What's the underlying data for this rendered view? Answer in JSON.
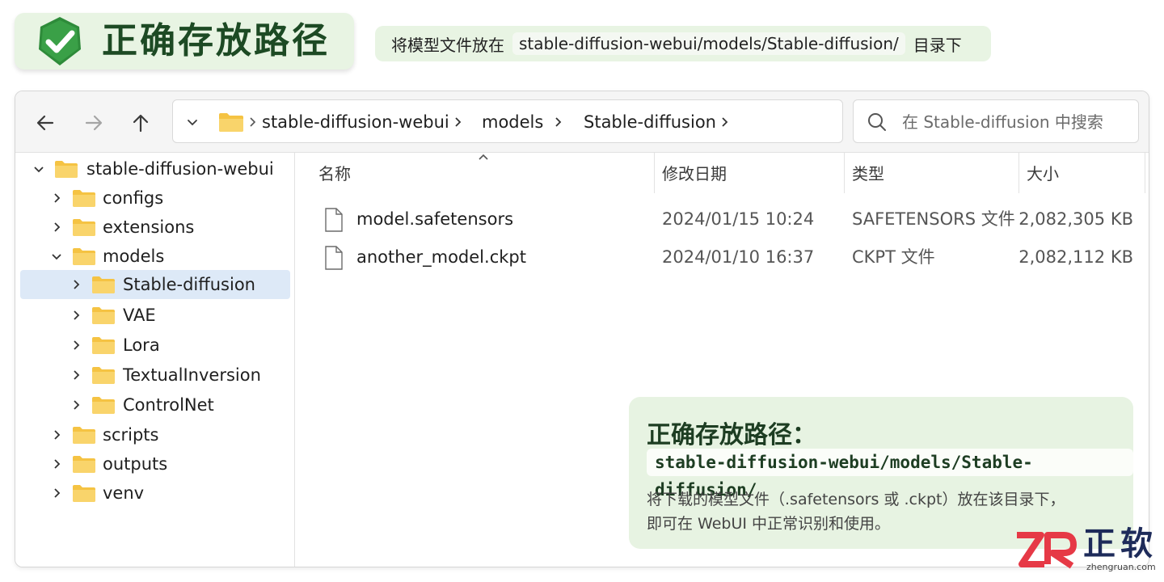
{
  "banner": {
    "title": "正确存放路径",
    "hint_prefix": "将模型文件放在",
    "hint_path": "stable-diffusion-webui/models/Stable-diffusion/",
    "hint_suffix": "目录下"
  },
  "toolbar": {
    "back_icon": "arrow-left-icon",
    "forward_icon": "arrow-right-icon",
    "up_icon": "arrow-up-icon",
    "breadcrumb": [
      "stable-diffusion-webui",
      "models",
      "Stable-diffusion"
    ],
    "search_placeholder": "在 Stable-diffusion 中搜索"
  },
  "tree": {
    "items": [
      {
        "label": "stable-diffusion-webui",
        "expanded": true
      },
      {
        "label": "configs",
        "expanded": false
      },
      {
        "label": "extensions",
        "expanded": false
      },
      {
        "label": "models",
        "expanded": true
      },
      {
        "label": "Stable-diffusion",
        "expanded": false,
        "selected": true
      },
      {
        "label": "VAE",
        "expanded": false
      },
      {
        "label": "Lora",
        "expanded": false
      },
      {
        "label": "TextualInversion",
        "expanded": false
      },
      {
        "label": "ControlNet",
        "expanded": false
      },
      {
        "label": "scripts",
        "expanded": false
      },
      {
        "label": "outputs",
        "expanded": false
      },
      {
        "label": "venv",
        "expanded": false
      }
    ]
  },
  "file_list": {
    "columns": [
      "名称",
      "修改日期",
      "类型",
      "大小"
    ],
    "rows": [
      {
        "name": "model.safetensors",
        "date": "2024/01/15 10:24",
        "type": "SAFETENSORS 文件",
        "size": "2,082,305 KB"
      },
      {
        "name": "another_model.ckpt",
        "date": "2024/01/10 16:37",
        "type": "CKPT 文件",
        "size": "2,082,112 KB"
      }
    ]
  },
  "callout": {
    "title": "正确存放路径：",
    "path": "stable-diffusion-webui/models/Stable-diffusion/",
    "note_line1": "将下载的模型文件（.safetensors 或 .ckpt）放在该目录下，",
    "note_line2": "即可在 WebUI 中正常识别和使用。"
  },
  "logo": {
    "text": "正软",
    "url": "zhengruan.com"
  },
  "colors": {
    "accent_green": "#2e8b3a",
    "folder_yellow": "#f7c948",
    "selection_blue": "#dde9f7",
    "logo_red": "#e63946",
    "logo_navy": "#1e2b5a"
  }
}
